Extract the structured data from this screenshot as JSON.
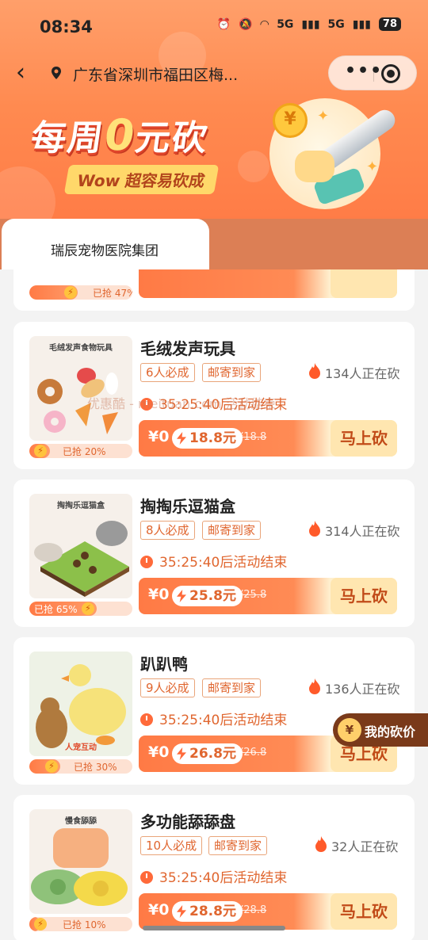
{
  "status": {
    "time": "08:34",
    "battery": "78",
    "net1": "5G",
    "net2": "5G"
  },
  "nav": {
    "location": "广东省深圳市福田区梅..."
  },
  "banner": {
    "title_a": "每周",
    "title_zero": "0",
    "title_b": "元砍",
    "subtitle": "Wow 超容易砍成",
    "coin": "¥"
  },
  "tabs": [
    {
      "label": "瑞辰宠物医院集团"
    }
  ],
  "top_partial": {
    "progress_label": "已抢 47%",
    "progress": 0.47
  },
  "products": [
    {
      "name": "毛绒发声玩具",
      "thumb_caption": "毛绒发声食物玩具",
      "tags": [
        "6人必成",
        "邮寄到家"
      ],
      "bargaining": "134人正在砍",
      "countdown": "35:25:40后活动结束",
      "price_now": "¥0",
      "chip": "18.8元",
      "orig": "¥18.8",
      "button": "马上砍",
      "progress_label": "已抢 20%",
      "progress": 0.2
    },
    {
      "name": "掏掏乐逗猫盒",
      "thumb_caption": "掏掏乐逗猫盒",
      "tags": [
        "8人必成",
        "邮寄到家"
      ],
      "bargaining": "314人正在砍",
      "countdown": "35:25:40后活动结束",
      "price_now": "¥0",
      "chip": "25.8元",
      "orig": "¥25.8",
      "button": "马上砍",
      "progress_label": "已抢 65%",
      "progress": 0.65
    },
    {
      "name": "趴趴鸭",
      "thumb_caption": "人宠互动",
      "tags": [
        "9人必成",
        "邮寄到家"
      ],
      "bargaining": "136人正在砍",
      "countdown": "35:25:40后活动结束",
      "price_now": "¥0",
      "chip": "26.8元",
      "orig": "¥26.8",
      "button": "马上砍",
      "progress_label": "已抢 30%",
      "progress": 0.3
    },
    {
      "name": "多功能舔舔盘",
      "thumb_caption": "慢食舔舔",
      "tags": [
        "10人必成",
        "邮寄到家"
      ],
      "bargaining": "32人正在砍",
      "countdown": "35:25:40后活动结束",
      "price_now": "¥0",
      "chip": "28.8元",
      "orig": "¥28.8",
      "button": "马上砍",
      "progress_label": "已抢 10%",
      "progress": 0.1
    }
  ],
  "floating": {
    "label": "我的砍价",
    "icon": "¥"
  },
  "watermark": "优惠酷 - meituan.com 活动结束"
}
